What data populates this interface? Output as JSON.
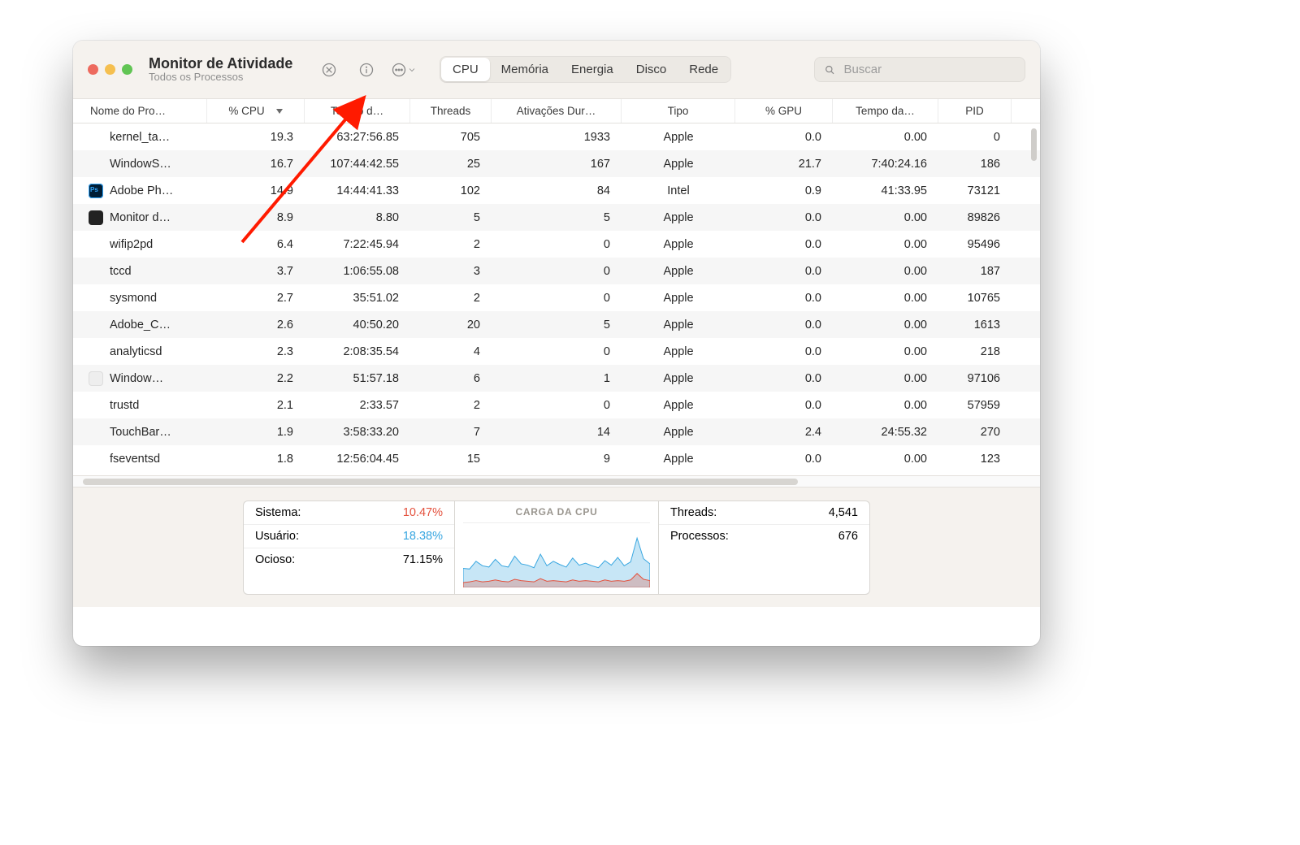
{
  "window": {
    "title": "Monitor de Atividade",
    "subtitle": "Todos os Processos"
  },
  "search": {
    "placeholder": "Buscar"
  },
  "tabs": {
    "items": [
      "CPU",
      "Memória",
      "Energia",
      "Disco",
      "Rede"
    ],
    "active": 0
  },
  "columns": [
    "Nome do Pro…",
    "% CPU",
    "Tempo d…",
    "Threads",
    "Ativações Dur…",
    "Tipo",
    "% GPU",
    "Tempo da…",
    "PID"
  ],
  "sort_column_index": 1,
  "rows": [
    {
      "icon": "",
      "name": "kernel_ta…",
      "cpu": "19.3",
      "time": "63:27:56.85",
      "threads": "705",
      "wake": "1933",
      "kind": "Apple",
      "gpu": "0.0",
      "gputime": "0.00",
      "pid": "0"
    },
    {
      "icon": "",
      "name": "WindowS…",
      "cpu": "16.7",
      "time": "107:44:42.55",
      "threads": "25",
      "wake": "167",
      "kind": "Apple",
      "gpu": "21.7",
      "gputime": "7:40:24.16",
      "pid": "186"
    },
    {
      "icon": "ps",
      "name": "Adobe Ph…",
      "cpu": "14.9",
      "time": "14:44:41.33",
      "threads": "102",
      "wake": "84",
      "kind": "Intel",
      "gpu": "0.9",
      "gputime": "41:33.95",
      "pid": "73121"
    },
    {
      "icon": "am",
      "name": "Monitor d…",
      "cpu": "8.9",
      "time": "8.80",
      "threads": "5",
      "wake": "5",
      "kind": "Apple",
      "gpu": "0.0",
      "gputime": "0.00",
      "pid": "89826"
    },
    {
      "icon": "",
      "name": "wifip2pd",
      "cpu": "6.4",
      "time": "7:22:45.94",
      "threads": "2",
      "wake": "0",
      "kind": "Apple",
      "gpu": "0.0",
      "gputime": "0.00",
      "pid": "95496"
    },
    {
      "icon": "",
      "name": "tccd",
      "cpu": "3.7",
      "time": "1:06:55.08",
      "threads": "3",
      "wake": "0",
      "kind": "Apple",
      "gpu": "0.0",
      "gputime": "0.00",
      "pid": "187"
    },
    {
      "icon": "",
      "name": "sysmond",
      "cpu": "2.7",
      "time": "35:51.02",
      "threads": "2",
      "wake": "0",
      "kind": "Apple",
      "gpu": "0.0",
      "gputime": "0.00",
      "pid": "10765"
    },
    {
      "icon": "",
      "name": "Adobe_C…",
      "cpu": "2.6",
      "time": "40:50.20",
      "threads": "20",
      "wake": "5",
      "kind": "Apple",
      "gpu": "0.0",
      "gputime": "0.00",
      "pid": "1613"
    },
    {
      "icon": "",
      "name": "analyticsd",
      "cpu": "2.3",
      "time": "2:08:35.54",
      "threads": "4",
      "wake": "0",
      "kind": "Apple",
      "gpu": "0.0",
      "gputime": "0.00",
      "pid": "218"
    },
    {
      "icon": "blank",
      "name": "Window…",
      "cpu": "2.2",
      "time": "51:57.18",
      "threads": "6",
      "wake": "1",
      "kind": "Apple",
      "gpu": "0.0",
      "gputime": "0.00",
      "pid": "97106"
    },
    {
      "icon": "",
      "name": "trustd",
      "cpu": "2.1",
      "time": "2:33.57",
      "threads": "2",
      "wake": "0",
      "kind": "Apple",
      "gpu": "0.0",
      "gputime": "0.00",
      "pid": "57959"
    },
    {
      "icon": "",
      "name": "TouchBar…",
      "cpu": "1.9",
      "time": "3:58:33.20",
      "threads": "7",
      "wake": "14",
      "kind": "Apple",
      "gpu": "2.4",
      "gputime": "24:55.32",
      "pid": "270"
    },
    {
      "icon": "",
      "name": "fseventsd",
      "cpu": "1.8",
      "time": "12:56:04.45",
      "threads": "15",
      "wake": "9",
      "kind": "Apple",
      "gpu": "0.0",
      "gputime": "0.00",
      "pid": "123"
    }
  ],
  "footer": {
    "left": [
      {
        "label": "Sistema:",
        "value": "10.47%",
        "cls": "v-red"
      },
      {
        "label": "Usuário:",
        "value": "18.38%",
        "cls": "v-blue"
      },
      {
        "label": "Ocioso:",
        "value": "71.15%",
        "cls": ""
      }
    ],
    "mid_title": "CARGA DA CPU",
    "right": [
      {
        "label": "Threads:",
        "value": "4,541"
      },
      {
        "label": "Processos:",
        "value": "676"
      }
    ]
  },
  "chart_data": {
    "type": "area",
    "title": "CARGA DA CPU",
    "ylim": [
      0,
      100
    ],
    "series": [
      {
        "name": "Sistema",
        "color": "#e4513d",
        "values": [
          8,
          9,
          11,
          9,
          10,
          12,
          10,
          9,
          13,
          11,
          10,
          9,
          14,
          10,
          11,
          10,
          9,
          12,
          10,
          11,
          10,
          9,
          12,
          10,
          11,
          10,
          12,
          22,
          13,
          11
        ]
      },
      {
        "name": "Usuário",
        "color": "#37a6e0",
        "values": [
          22,
          20,
          30,
          25,
          22,
          32,
          24,
          23,
          36,
          26,
          25,
          22,
          38,
          24,
          30,
          26,
          23,
          34,
          25,
          27,
          24,
          22,
          30,
          25,
          36,
          24,
          28,
          55,
          32,
          26
        ]
      }
    ]
  }
}
